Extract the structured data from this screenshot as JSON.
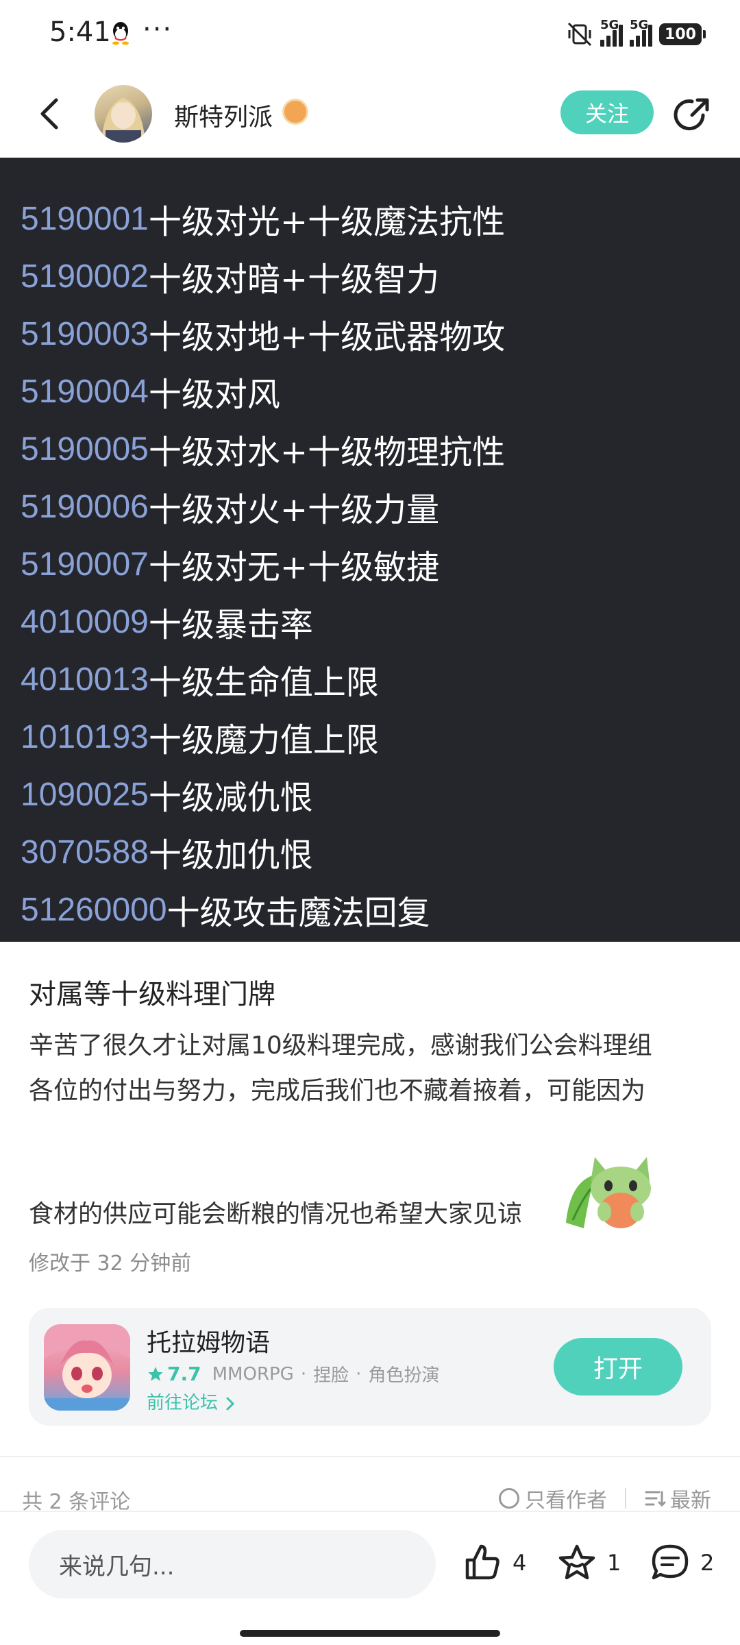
{
  "status_bar": {
    "time": "5:41",
    "dots": "···",
    "network1": "5G",
    "network2": "5G",
    "battery": "100"
  },
  "header": {
    "author_name": "斯特列派",
    "follow_label": "关注"
  },
  "image_lines": [
    {
      "id": "5190001",
      "desc": "十级对光+十级魔法抗性"
    },
    {
      "id": "5190002",
      "desc": " 十级对暗+十级智力"
    },
    {
      "id": "5190003",
      "desc": " 十级对地+十级武器物攻"
    },
    {
      "id": "5190004",
      "desc": " 十级对风"
    },
    {
      "id": "5190005",
      "desc": " 十级对水+十级物理抗性"
    },
    {
      "id": "5190006",
      "desc": " 十级对火+十级力量"
    },
    {
      "id": "5190007",
      "desc": " 十级对无+十级敏捷"
    },
    {
      "id": "4010009",
      "desc": "  十级暴击率"
    },
    {
      "id": "4010013",
      "desc": "  十级生命值上限"
    },
    {
      "id": "1010193",
      "desc": " 十级魔力值上限"
    },
    {
      "id": "1090025",
      "desc": "  十级减仇恨"
    },
    {
      "id": "3070588",
      "desc": "  十级加仇恨"
    },
    {
      "id": "51260000",
      "desc": "  十级攻击魔法回复"
    }
  ],
  "post": {
    "title": "对属等十级料理门牌",
    "body_line1": "辛苦了很久才让对属10级料理完成，感谢我们公会料理组",
    "body_line2": "各位的付出与努力，完成后我们也不藏着掖着，可能因为",
    "body_line3": "食材的供应可能会断粮的情况也希望大家见谅",
    "edit_time": "修改于 32 分钟前"
  },
  "game_card": {
    "name": "托拉姆物语",
    "rating": "7.7",
    "genre1": "MMORPG",
    "genre2": "捏脸",
    "genre3": "角色扮演",
    "dot": "·",
    "forum_link": "前往论坛",
    "open_label": "打开"
  },
  "comments_bar": {
    "count": "共 2 条评论",
    "author_only": "只看作者",
    "sort": "最新"
  },
  "bottom_bar": {
    "input_placeholder": "来说几句...",
    "likes": "4",
    "favorites": "1",
    "comments": "2"
  },
  "colors": {
    "accent": "#4fd1bc",
    "image_bg": "#24262b",
    "code_id": "#8aa2d8"
  }
}
